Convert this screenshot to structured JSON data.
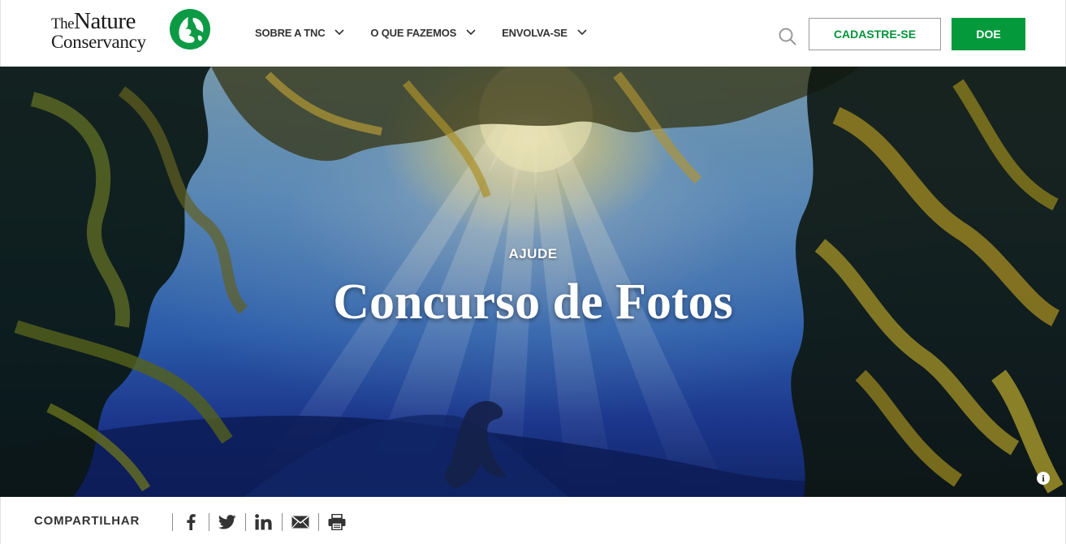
{
  "header": {
    "logo": {
      "line1_small": "The",
      "line1_large": "Nature",
      "line2": "Conservancy",
      "icon": "tnc-leaf-globe-icon"
    },
    "nav": [
      {
        "label": "SOBRE A TNC",
        "icon": "chevron-down-icon"
      },
      {
        "label": "O QUE FAZEMOS",
        "icon": "chevron-down-icon"
      },
      {
        "label": "ENVOLVA-SE",
        "icon": "chevron-down-icon"
      }
    ],
    "search_icon": "search-icon",
    "signup_label": "CADASTRE-SE",
    "donate_label": "DOE"
  },
  "hero": {
    "kicker": "AJUDE",
    "title": "Concurso de Fotos",
    "info_label": "i"
  },
  "share": {
    "label": "COMPARTILHAR",
    "icons": [
      "facebook-icon",
      "twitter-icon",
      "linkedin-icon",
      "email-icon",
      "print-icon"
    ]
  },
  "colors": {
    "brand_green": "#049a3c",
    "brand_green_text": "#03933a",
    "nav_text": "#333333"
  }
}
